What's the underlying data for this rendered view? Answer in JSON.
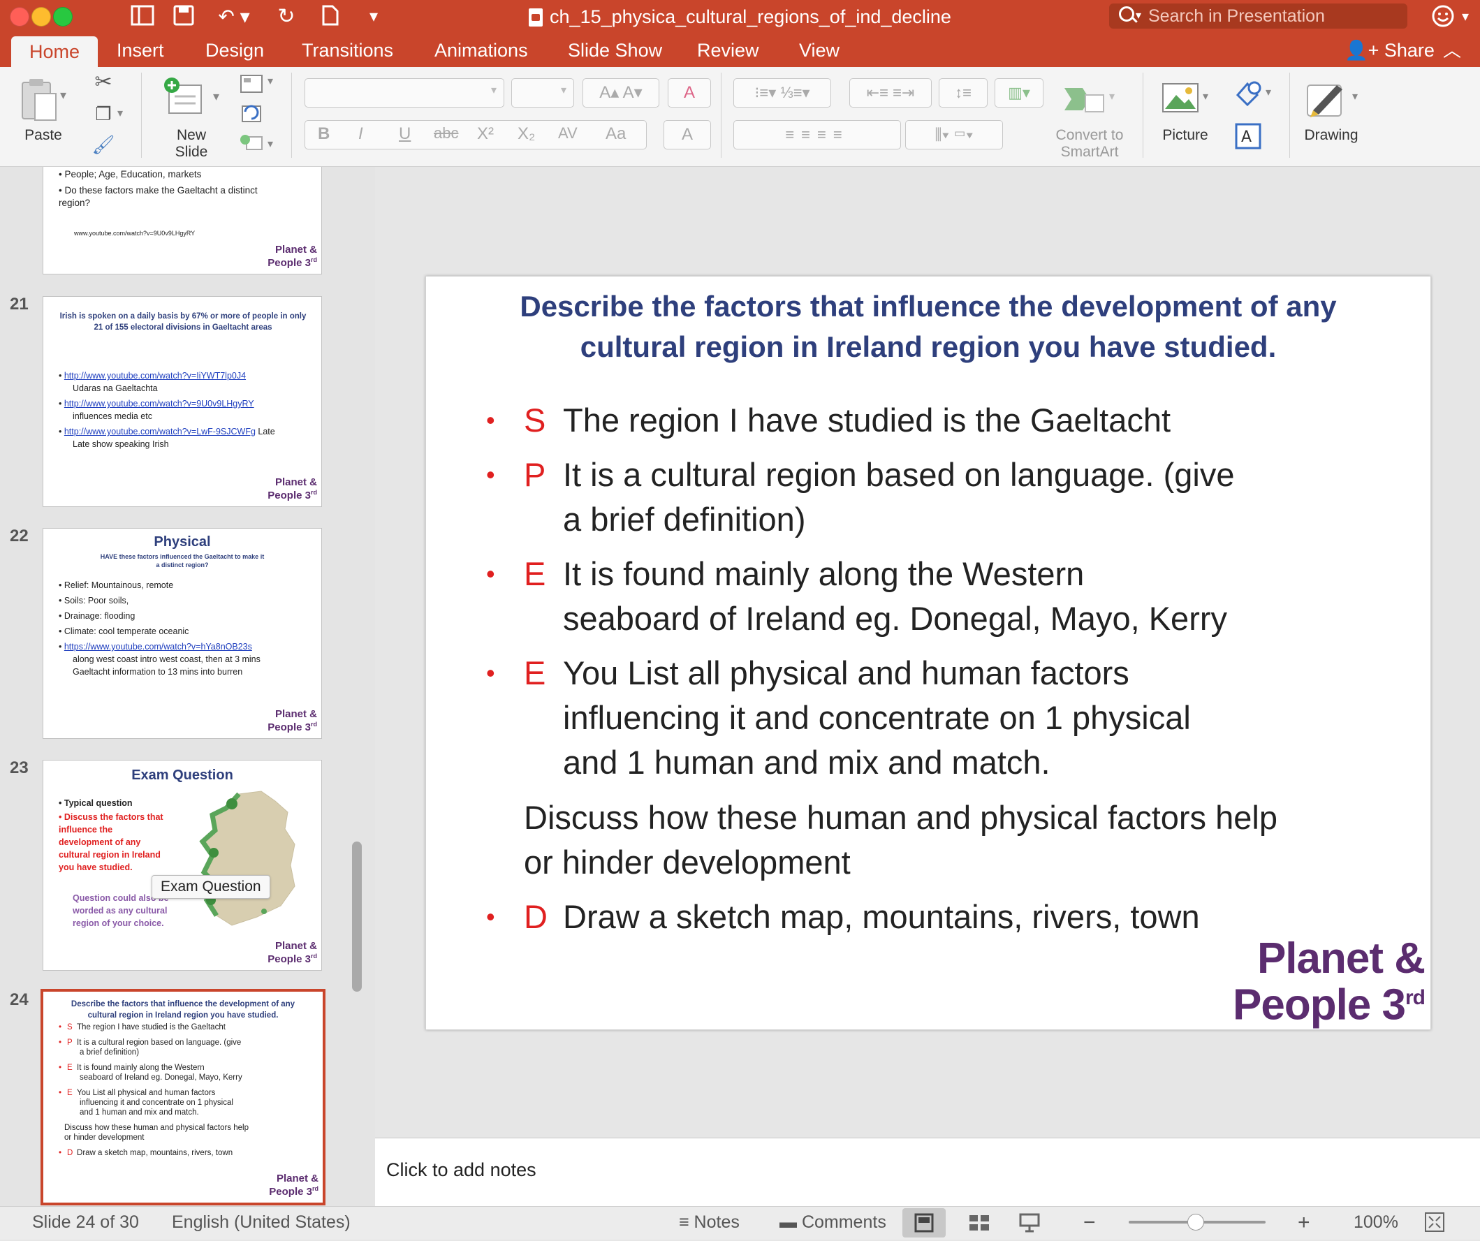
{
  "window": {
    "title": "ch_15_physica_cultural_regions_of_ind_decline",
    "search_placeholder": "Search in Presentation",
    "traffic_colors": [
      "#ff5f57",
      "#febc2e",
      "#28c840"
    ]
  },
  "tabs": [
    "Home",
    "Insert",
    "Design",
    "Transitions",
    "Animations",
    "Slide Show",
    "Review",
    "View"
  ],
  "active_tab": "Home",
  "share_label": "Share",
  "ribbon": {
    "paste": "Paste",
    "new_slide_line1": "New",
    "new_slide_line2": "Slide",
    "convert_line1": "Convert to",
    "convert_line2": "SmartArt",
    "picture": "Picture",
    "drawing": "Drawing",
    "format_buttons": [
      "B",
      "I",
      "U",
      "abc",
      "X²",
      "X₂",
      "AV",
      "Aa",
      "A"
    ],
    "font_size_buttons": [
      "A▴",
      "A▾"
    ]
  },
  "thumbnails": {
    "slide20_partial": {
      "bullets": [
        "People; Age, Education, markets",
        "Do these factors make the Gaeltacht a distinct region?"
      ],
      "link": "www.youtube.com/watch?v=9U0v9LHgyRY"
    },
    "slide21": {
      "number": "21",
      "title": "Irish is spoken on a daily basis by 67% or more of people in only 21 of 155 electoral divisions in Gaeltacht areas",
      "link1": "http://www.youtube.com/watch?v=IiYWT7lp0J4",
      "note1": "Udaras na Gaeltachta",
      "link2": "http://www.youtube.com/watch?v=9U0v9LHgyRY",
      "note2": "influences media etc",
      "link3": "http://www.youtube.com/watch?v=LwF-9SJCWFg",
      "note3a": "Late",
      "note3b": "Late show speaking Irish"
    },
    "slide22": {
      "number": "22",
      "title": "Physical",
      "subtitle": "HAVE these factors influenced the Gaeltacht to make it a distinct region?",
      "bullets": [
        "Relief: Mountainous, remote",
        "Soils: Poor soils,",
        "Drainage: flooding",
        "Climate: cool temperate oceanic"
      ],
      "link": "https://www.youtube.com/watch?v=hYa8nOB23s",
      "note": "along west coast intro west coast, then at 3 mins Gaeltacht information to 13 mins into burren"
    },
    "slide23": {
      "number": "23",
      "title": "Exam Question",
      "b1": "Typical question",
      "b2": "Discuss the factors that influence the development of any cultural region in Ireland  you have studied.",
      "b3": "Question could also be worded as any cultural region of your choice.",
      "tooltip": "Exam Question"
    },
    "slide24": {
      "number": "24",
      "title": "Describe the factors that influence the development of any cultural region in Ireland region you have studied.",
      "lines": [
        {
          "l": "S",
          "t": "The region I have studied is the Gaeltacht"
        },
        {
          "l": "P",
          "t": "It is a cultural region based on language. (give"
        },
        {
          "l": "",
          "t": "a brief definition)"
        },
        {
          "l": "E",
          "t": "It is found mainly along the Western"
        },
        {
          "l": "",
          "t": "seaboard of Ireland eg. Donegal, Mayo, Kerry"
        },
        {
          "l": "E",
          "t": "You List all physical and human factors"
        },
        {
          "l": "",
          "t": "influencing it and concentrate on 1 physical"
        },
        {
          "l": "",
          "t": "and 1 human and mix and match."
        },
        {
          "l": "",
          "t": "Discuss how these human and physical factors  help"
        },
        {
          "l": "",
          "t": "or hinder development"
        },
        {
          "l": "D",
          "t": "Draw a sketch map, mountains, rivers, town"
        }
      ]
    },
    "logo_line1": "Planet &",
    "logo_line2": "People 3",
    "logo_sup": "rd"
  },
  "slide": {
    "title": "Describe the factors that influence the development of any cultural region in Ireland region you have studied.",
    "s_letter": "S",
    "s_text": "The region I have studied is the Gaeltacht",
    "p_letter": "P",
    "p_text1": "It is a cultural region based on language. (give",
    "p_text2": "a brief definition)",
    "e1_letter": "E",
    "e1_text1": "It is found mainly along the Western",
    "e1_text2": "seaboard of Ireland eg. Donegal, Mayo, Kerry",
    "e2_letter": "E",
    "e2_text1": "You List all physical and human factors",
    "e2_text2": "influencing it and concentrate on 1 physical",
    "e2_text3": "and 1 human and mix and match.",
    "discuss1": "Discuss how these human and physical factors  help",
    "discuss2": "or hinder development",
    "d_letter": "D",
    "d_text": "Draw a sketch map, mountains, rivers, town",
    "logo_line1": "Planet &",
    "logo_line2": "People 3",
    "logo_sup": "rd"
  },
  "notes_placeholder": "Click to add notes",
  "status": {
    "slide_counter": "Slide 24 of 30",
    "language": "English (United States)",
    "notes": "Notes",
    "comments": "Comments",
    "zoom": "100%"
  },
  "colors": {
    "accent": "#c9452b",
    "title_blue": "#2e3f7c",
    "bullet_red": "#e02020",
    "logo_purple": "#5b2c6f"
  }
}
